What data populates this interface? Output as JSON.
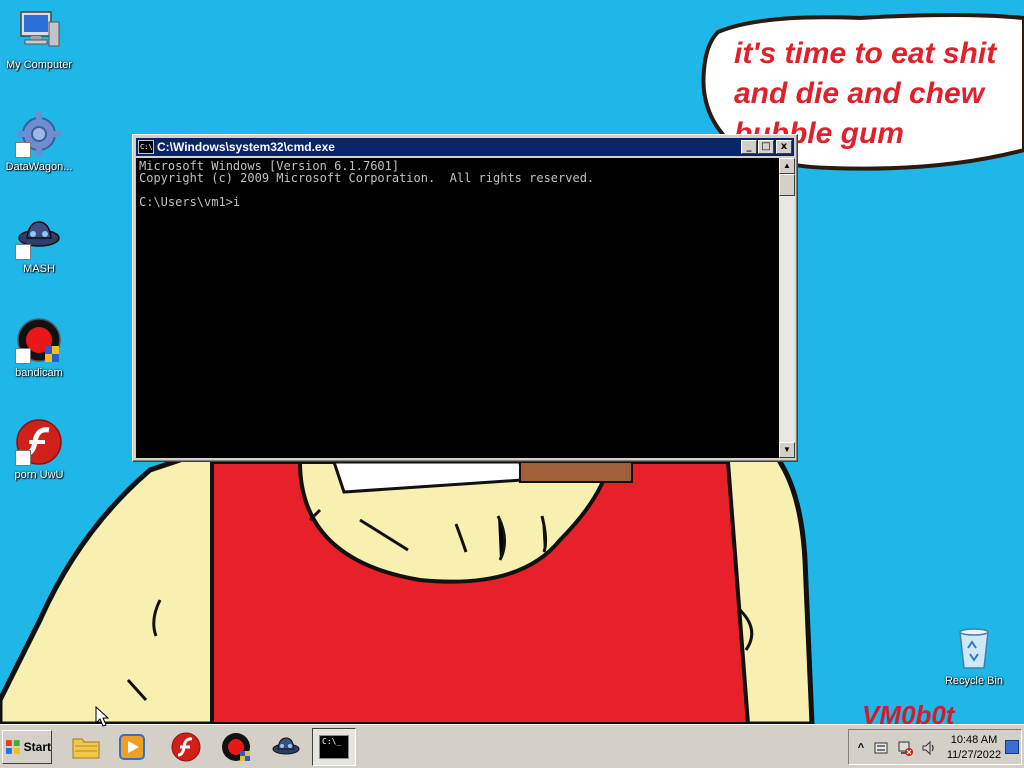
{
  "desktop": {
    "icons": [
      {
        "label": "My Computer",
        "icon": "computer-icon"
      },
      {
        "label": "DataWagon...",
        "icon": "gear-icon"
      },
      {
        "label": "MASH",
        "icon": "mash-icon"
      },
      {
        "label": "bandicam",
        "icon": "bandicam-icon"
      },
      {
        "label": "porn UwU",
        "icon": "flash-icon"
      },
      {
        "label": "Recycle Bin",
        "icon": "recycle-bin-icon"
      }
    ]
  },
  "wallpaper": {
    "bubble_text": "it's time to eat shit and die and chew bubble gum",
    "signature": "VM0b0t",
    "colors": {
      "sky": "#1fb6e8",
      "shirt": "#e8202a",
      "skin": "#f8f0b0"
    }
  },
  "cmd_window": {
    "title": "C:\\Windows\\system32\\cmd.exe",
    "title_icon_glyph": "C:\\",
    "buttons": {
      "minimize": "_",
      "maximize": "□",
      "close": "x"
    },
    "output_lines": [
      "Microsoft Windows [Version 6.1.7601]",
      "Copyright (c) 2009 Microsoft Corporation.  All rights reserved.",
      "",
      "C:\\Users\\vm1>i"
    ]
  },
  "taskbar": {
    "start_label": "Start",
    "items": [
      {
        "name": "explorer",
        "icon": "folder-icon"
      },
      {
        "name": "media-player",
        "icon": "media-player-icon"
      },
      {
        "name": "flash",
        "icon": "flash-icon"
      },
      {
        "name": "bandicam",
        "icon": "bandicam-icon"
      },
      {
        "name": "mash",
        "icon": "mash-icon"
      },
      {
        "name": "cmd",
        "icon": "cmd-icon",
        "active": true,
        "glyph": "C:\\_"
      }
    ],
    "tray": {
      "show_hidden_label": "^",
      "icons": [
        "action-center-icon",
        "network-icon",
        "volume-icon"
      ],
      "time": "10:48 AM",
      "date": "11/27/2022"
    }
  }
}
